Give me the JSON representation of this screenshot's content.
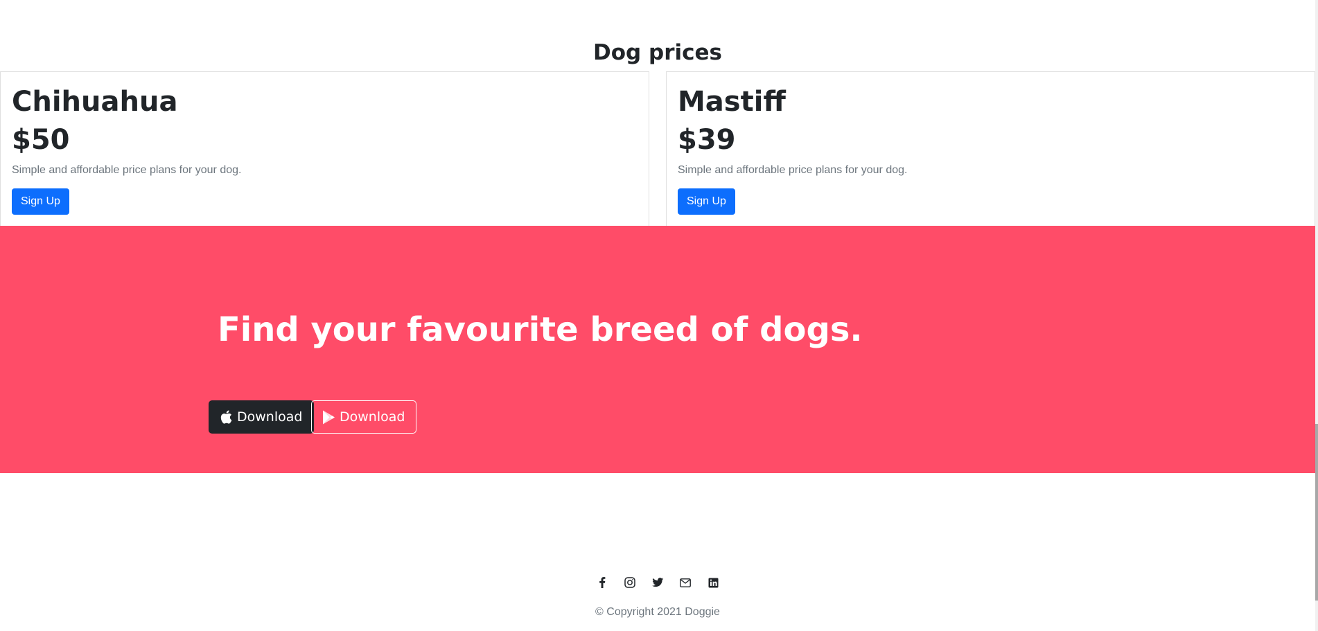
{
  "pricing": {
    "title": "Dog prices",
    "plans": [
      {
        "name": "Chihuahua",
        "price": "$50",
        "description": "Simple and affordable price plans for your dog.",
        "button_label": "Sign Up"
      },
      {
        "name": "Mastiff",
        "price": "$39",
        "description": "Simple and affordable price plans for your dog.",
        "button_label": "Sign Up"
      }
    ]
  },
  "cta": {
    "heading": "Find your favourite breed of dogs.",
    "buttons": [
      {
        "label": "Download",
        "icon": "apple-icon"
      },
      {
        "label": "Download",
        "icon": "google-play-icon"
      }
    ],
    "background_color": "#ff4c68"
  },
  "footer": {
    "social_icons": [
      "facebook-icon",
      "instagram-icon",
      "twitter-icon",
      "envelope-icon",
      "linkedin-icon"
    ],
    "copyright": "© Copyright 2021 Doggie"
  },
  "colors": {
    "primary": "#0d6efd",
    "dark": "#212529",
    "muted": "#6c757d"
  }
}
